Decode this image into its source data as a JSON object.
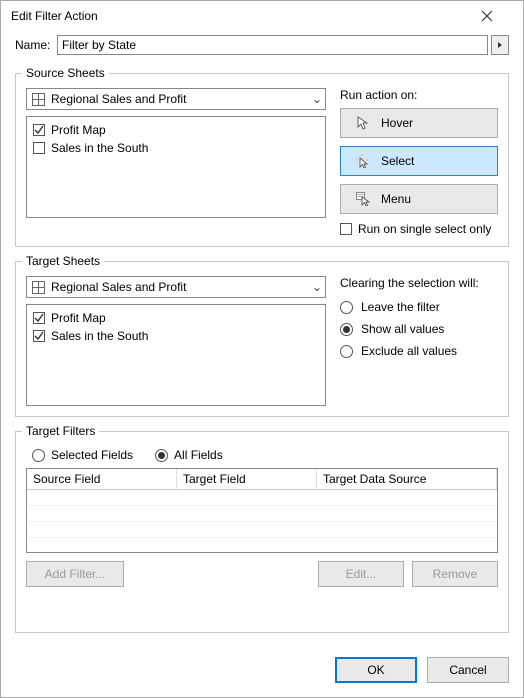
{
  "title": "Edit Filter Action",
  "name_label": "Name:",
  "name_value": "Filter by State",
  "source": {
    "legend": "Source Sheets",
    "workbook": "Regional Sales and Profit",
    "items": [
      {
        "label": "Profit Map",
        "checked": true
      },
      {
        "label": "Sales in the South",
        "checked": false
      }
    ],
    "run_label": "Run action on:",
    "actions": {
      "hover": "Hover",
      "select": "Select",
      "menu": "Menu"
    },
    "single_select": "Run on single select only"
  },
  "target": {
    "legend": "Target Sheets",
    "workbook": "Regional Sales and Profit",
    "items": [
      {
        "label": "Profit Map",
        "checked": true
      },
      {
        "label": "Sales in the South",
        "checked": true
      }
    ],
    "clear_label": "Clearing the selection will:",
    "clear_options": {
      "leave": "Leave the filter",
      "show": "Show all values",
      "exclude": "Exclude all values"
    },
    "clear_selected": "show"
  },
  "filters": {
    "legend": "Target Filters",
    "mode_selected": "Selected Fields",
    "mode_all": "All Fields",
    "mode_value": "all",
    "cols": {
      "source": "Source Field",
      "target": "Target Field",
      "ds": "Target Data Source"
    },
    "add": "Add Filter...",
    "edit": "Edit...",
    "remove": "Remove"
  },
  "footer": {
    "ok": "OK",
    "cancel": "Cancel"
  }
}
